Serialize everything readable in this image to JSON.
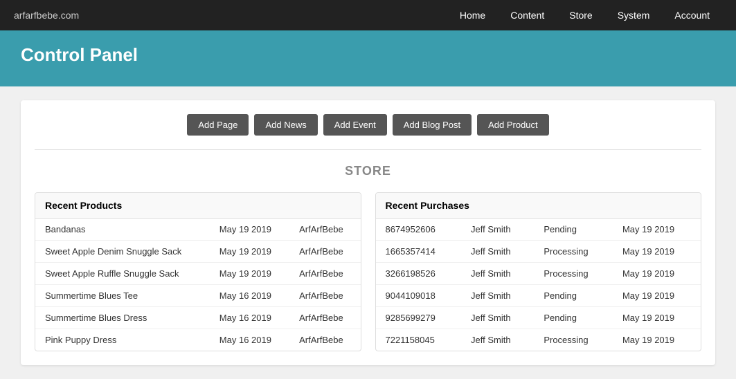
{
  "nav": {
    "brand": "arfarfbebe.com",
    "links": [
      "Home",
      "Content",
      "Store",
      "System",
      "Account"
    ]
  },
  "header": {
    "title": "Control Panel"
  },
  "toolbar": {
    "buttons": [
      "Add Page",
      "Add News",
      "Add Event",
      "Add Blog Post",
      "Add Product"
    ]
  },
  "store": {
    "section_title": "STORE",
    "recent_products": {
      "header": "Recent Products",
      "columns": [
        "name",
        "date",
        "author"
      ],
      "rows": [
        [
          "Bandanas",
          "May 19 2019",
          "ArfArfBebe"
        ],
        [
          "Sweet Apple Denim Snuggle Sack",
          "May 19 2019",
          "ArfArfBebe"
        ],
        [
          "Sweet Apple Ruffle Snuggle Sack",
          "May 19 2019",
          "ArfArfBebe"
        ],
        [
          "Summertime Blues Tee",
          "May 16 2019",
          "ArfArfBebe"
        ],
        [
          "Summertime Blues Dress",
          "May 16 2019",
          "ArfArfBebe"
        ],
        [
          "Pink Puppy Dress",
          "May 16 2019",
          "ArfArfBebe"
        ]
      ]
    },
    "recent_purchases": {
      "header": "Recent Purchases",
      "columns": [
        "order_id",
        "customer",
        "status",
        "date"
      ],
      "rows": [
        [
          "8674952606",
          "Jeff Smith",
          "Pending",
          "May 19 2019"
        ],
        [
          "1665357414",
          "Jeff Smith",
          "Processing",
          "May 19 2019"
        ],
        [
          "3266198526",
          "Jeff Smith",
          "Processing",
          "May 19 2019"
        ],
        [
          "9044109018",
          "Jeff Smith",
          "Pending",
          "May 19 2019"
        ],
        [
          "9285699279",
          "Jeff Smith",
          "Pending",
          "May 19 2019"
        ],
        [
          "7221158045",
          "Jeff Smith",
          "Processing",
          "May 19 2019"
        ]
      ]
    }
  }
}
